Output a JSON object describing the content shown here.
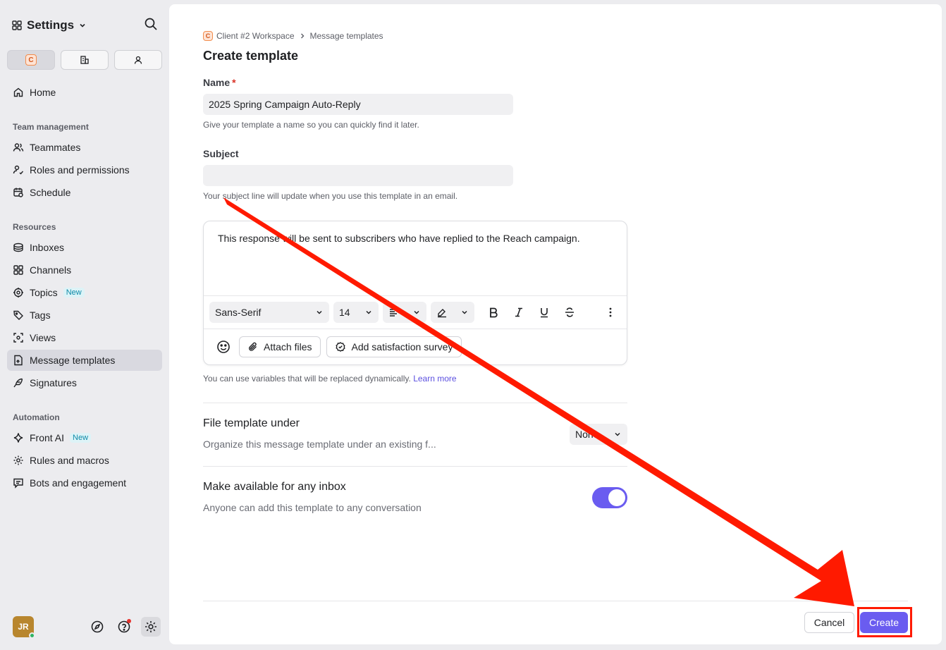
{
  "sidebar": {
    "title": "Settings",
    "workspace_badge": "C",
    "home": "Home",
    "sections": {
      "team_management": "Team management",
      "resources": "Resources",
      "automation": "Automation"
    },
    "team_items": [
      "Teammates",
      "Roles and permissions",
      "Schedule"
    ],
    "resource_items": [
      "Inboxes",
      "Channels",
      "Topics",
      "Tags",
      "Views",
      "Message templates",
      "Signatures"
    ],
    "automation_items": [
      "Front AI",
      "Rules and macros",
      "Bots and engagement"
    ],
    "new_badge": "New",
    "avatar_initials": "JR"
  },
  "breadcrumb": {
    "workspace_badge": "C",
    "workspace": "Client #2 Workspace",
    "page": "Message templates"
  },
  "form": {
    "title": "Create template",
    "name_label": "Name",
    "required_mark": "*",
    "name_value": "2025 Spring Campaign Auto-Reply",
    "name_hint": "Give your template a name so you can quickly find it later.",
    "subject_label": "Subject",
    "subject_value": "",
    "subject_hint": "Your subject line will update when you use this template in an email.",
    "body": "This response will be sent to subscribers who have replied to the Reach campaign.",
    "font_family": "Sans-Serif",
    "font_size": "14",
    "attach_files": "Attach files",
    "add_survey": "Add satisfaction survey",
    "variables_hint": "You can use variables that will be replaced dynamically.",
    "learn_more": "Learn more",
    "file_under_title": "File template under",
    "file_under_desc": "Organize this message template under an existing f...",
    "file_under_value": "None",
    "available_title": "Make available for any inbox",
    "available_desc": "Anyone can add this template to any conversation",
    "available_on": true
  },
  "footer": {
    "cancel": "Cancel",
    "create": "Create"
  },
  "colors": {
    "accent": "#6a5cf0",
    "annotation": "#ff1a00"
  }
}
